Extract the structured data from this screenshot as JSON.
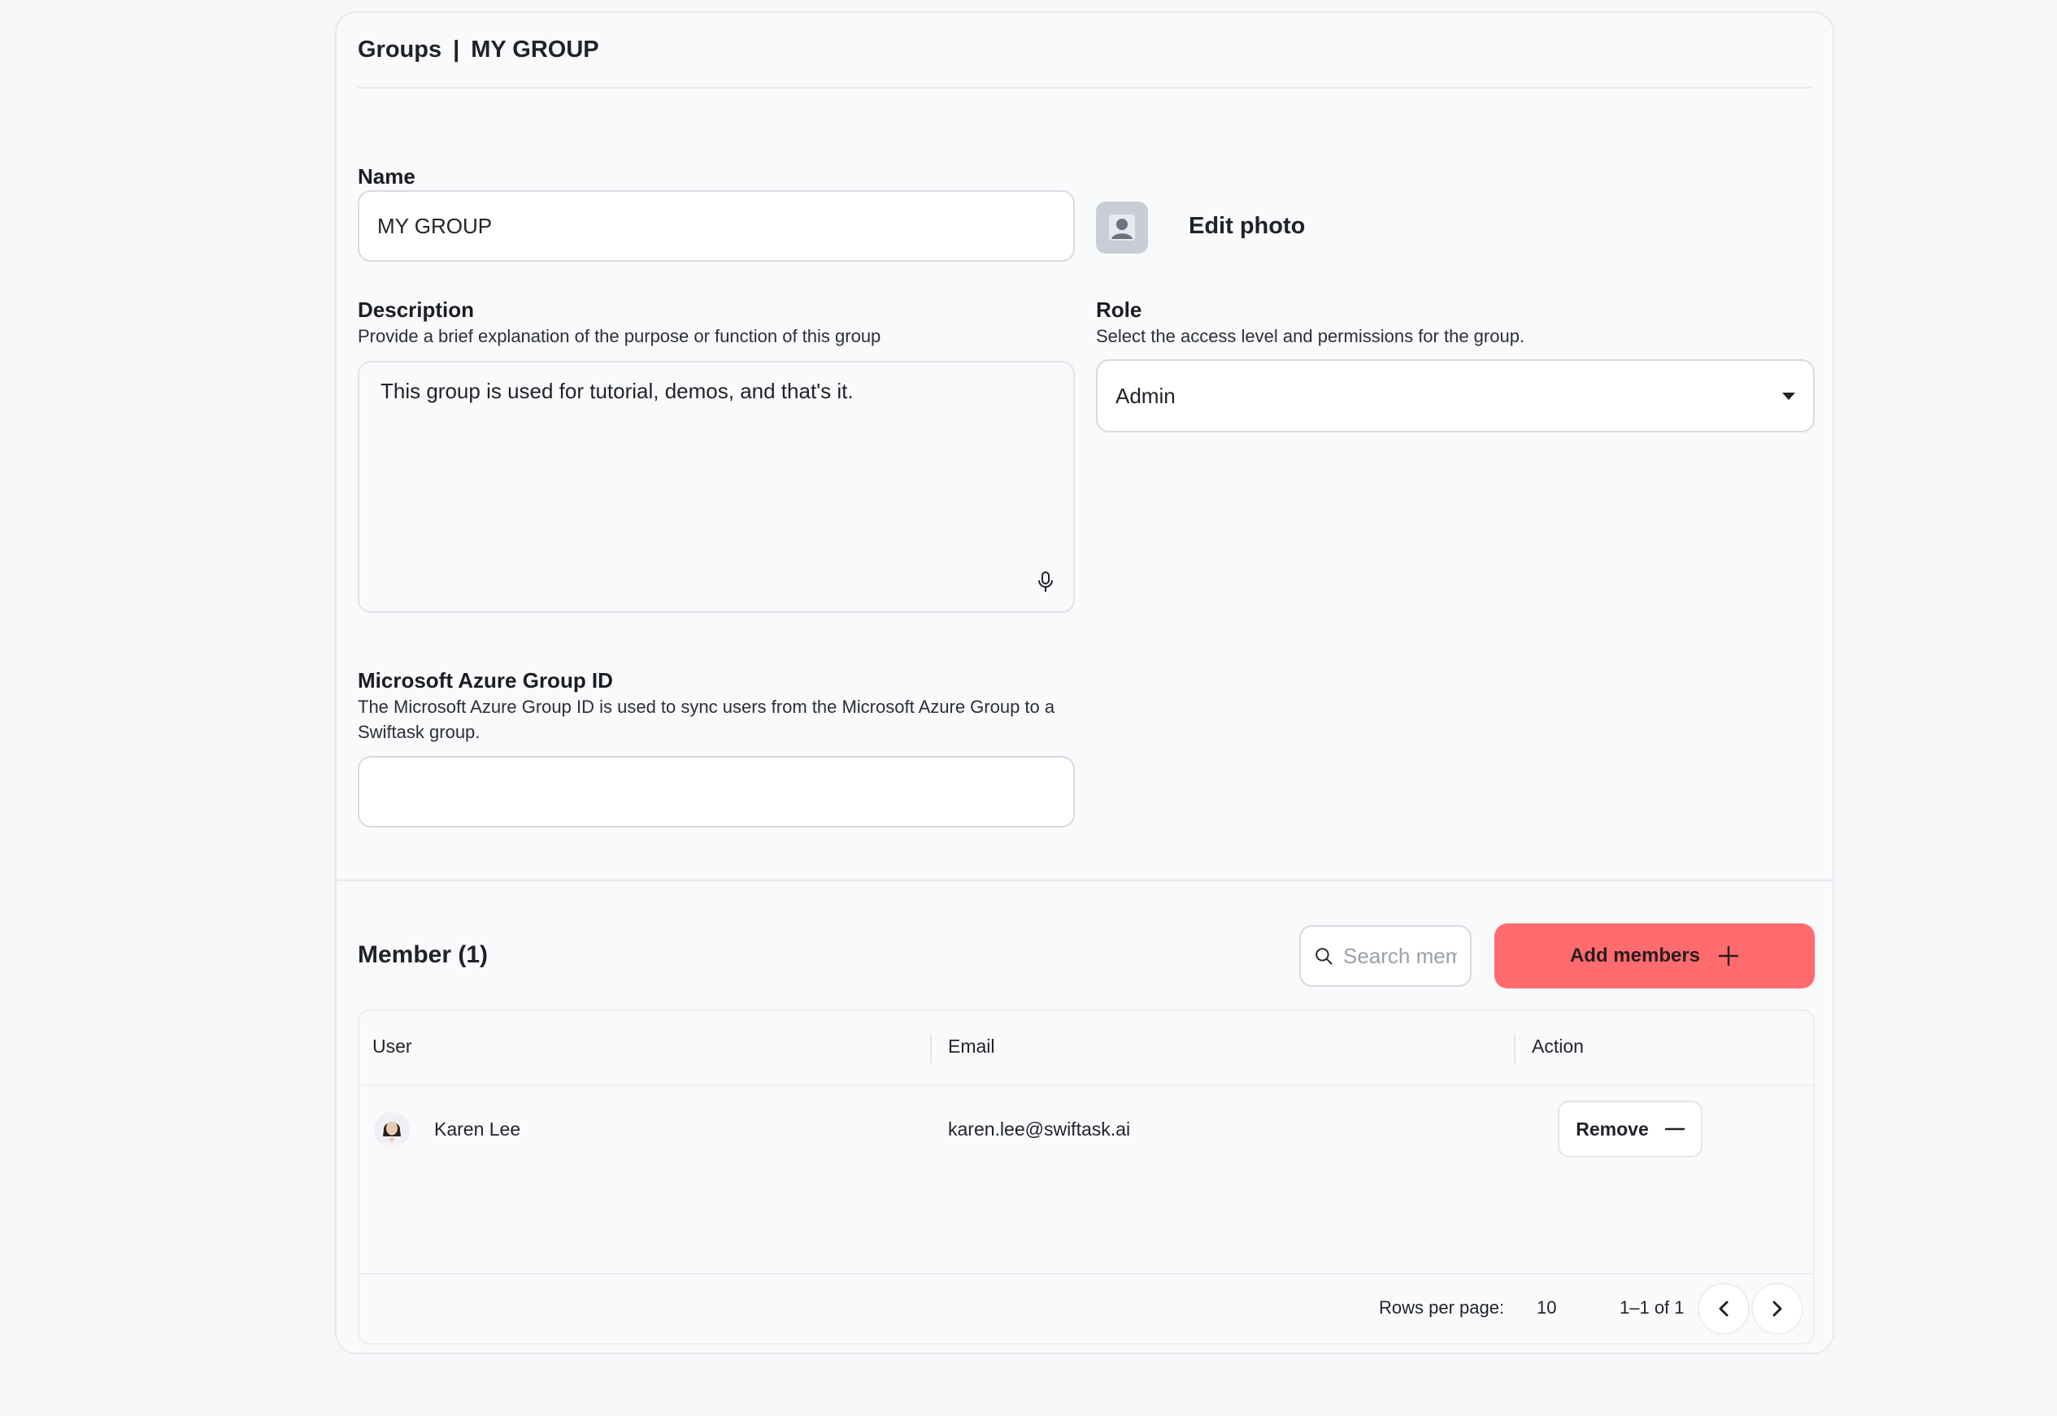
{
  "header": {
    "section": "Groups",
    "separator": "|",
    "group_name": "MY GROUP"
  },
  "form": {
    "name_label": "Name",
    "name_value": "MY GROUP",
    "edit_photo_label": "Edit photo",
    "description_label": "Description",
    "description_help": "Provide a brief explanation of the purpose or function of this group",
    "description_value": "This group is used for tutorial, demos, and that's it.",
    "role_label": "Role",
    "role_help": "Select the access level and permissions for the group.",
    "role_value": "Admin",
    "azure_label": "Microsoft Azure Group ID",
    "azure_help": "The Microsoft Azure Group ID is used to sync users from the Microsoft Azure Group to a Swiftask group.",
    "azure_value": ""
  },
  "members": {
    "title": "Member (1)",
    "search_placeholder": "Search members",
    "add_button_label": "Add members",
    "columns": [
      "User",
      "Email",
      "Action"
    ],
    "rows": [
      {
        "name": "Karen Lee",
        "email": "karen.lee@swiftask.ai",
        "action_label": "Remove"
      }
    ],
    "rows_per_page_label": "Rows per page:",
    "rows_per_page_value": "10",
    "range_label": "1–1 of 1"
  },
  "icons": {
    "mic": "microphone-icon",
    "search": "search-icon",
    "add": "plus-icon",
    "remove": "minus-icon",
    "prev": "chevron-left-icon",
    "next": "chevron-right-icon",
    "dropdown": "caret-down-icon",
    "photo": "user-placeholder-icon"
  },
  "colors": {
    "accent": "#fe6b6e",
    "background": "#f6f7f9",
    "card": "#f9fafb"
  }
}
